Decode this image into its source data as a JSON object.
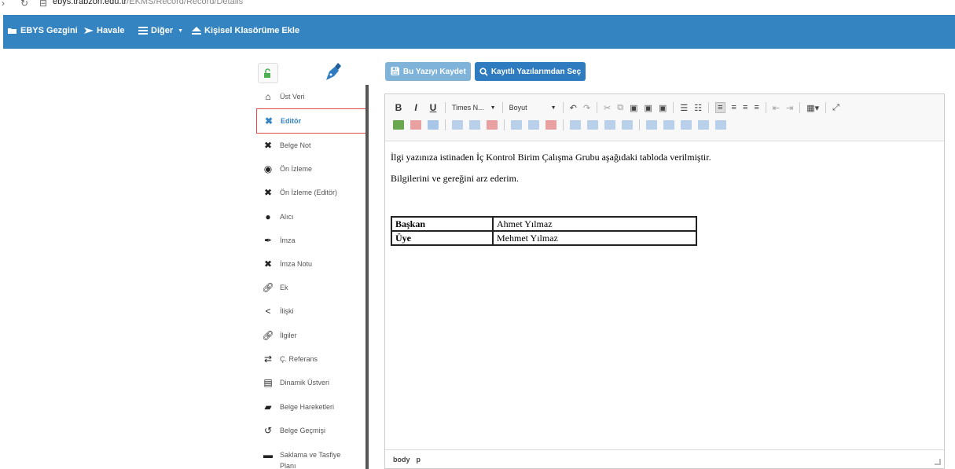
{
  "browser": {
    "url_host": "ebys.trabzon.edu.tr",
    "url_path": "/EKMS/Record/Record/Details"
  },
  "navbar": {
    "items": [
      {
        "label": "EBYS Gezgini",
        "icon": "folder-open-icon"
      },
      {
        "label": "Havale",
        "icon": "send-icon"
      },
      {
        "label": "Diğer",
        "icon": "list-icon",
        "dropdown": true
      },
      {
        "label": "Kişisel Klasörüme Ekle",
        "icon": "eject-icon"
      }
    ],
    "color": "#3584c2"
  },
  "sidebar": {
    "lock_icon": "unlock-icon",
    "pen_icon": "fountain-pen-icon",
    "items": [
      {
        "label": "Üst Veri",
        "icon": "home-icon"
      },
      {
        "label": "Editör",
        "icon": "x-icon",
        "active": true
      },
      {
        "label": "Belge Not",
        "icon": "x-icon"
      },
      {
        "label": "Ön İzleme",
        "icon": "eye-icon"
      },
      {
        "label": "Ön İzleme (Editör)",
        "icon": "x-icon"
      },
      {
        "label": "Alıcı",
        "icon": "user-icon"
      },
      {
        "label": "İmza",
        "icon": "pen-icon"
      },
      {
        "label": "İmza Notu",
        "icon": "x-icon"
      },
      {
        "label": "Ek",
        "icon": "paperclip-icon"
      },
      {
        "label": "İlişki",
        "icon": "share-icon"
      },
      {
        "label": "İlgiler",
        "icon": "paperclip-icon"
      },
      {
        "label": "Ç. Referans",
        "icon": "shuffle-icon"
      },
      {
        "label": "Dinamik Üstveri",
        "icon": "list-box-icon"
      },
      {
        "label": "Belge Hareketleri",
        "icon": "truck-icon"
      },
      {
        "label": "Belge Geçmişi",
        "icon": "history-icon"
      },
      {
        "label": "Saklama ve Tasfiye Planı",
        "icon": "archive-icon"
      }
    ]
  },
  "actions": {
    "save_label": "Bu Yazıyı Kaydet",
    "select_label": "Kayıtlı Yazılarımdan Seç"
  },
  "editor": {
    "font_combo": "Times N...",
    "size_combo": "Boyut",
    "paragraphs": [
      "İlgi yazınıza istinaden İç Kontrol Birim Çalışma Grubu aşağıdaki tabloda verilmiştir.",
      "Bilgilerini ve gereğini arz ederim."
    ],
    "table": [
      {
        "role": "Başkan",
        "name": "Ahmet Yılmaz"
      },
      {
        "role": "Üye",
        "name": "Mehmet Yılmaz"
      }
    ],
    "status_path": [
      "body",
      "p"
    ]
  }
}
